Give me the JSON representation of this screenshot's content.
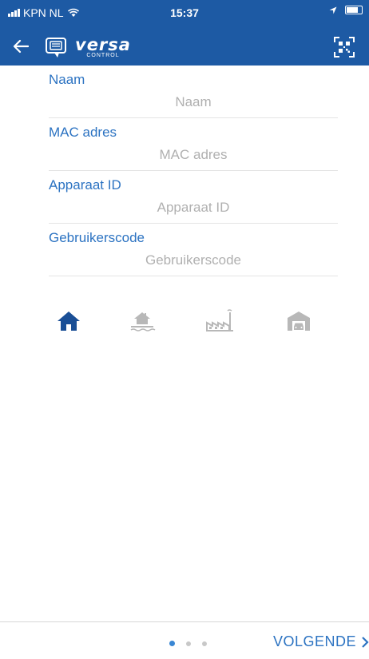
{
  "status": {
    "carrier": "KPN NL",
    "time": "15:37"
  },
  "header": {
    "brand": "versa",
    "brand_sub": "CONTROL"
  },
  "form": {
    "fields": [
      {
        "label": "Naam",
        "placeholder": "Naam",
        "value": ""
      },
      {
        "label": "MAC adres",
        "placeholder": "MAC adres",
        "value": ""
      },
      {
        "label": "Apparaat ID",
        "placeholder": "Apparaat ID",
        "value": ""
      },
      {
        "label": "Gebruikerscode",
        "placeholder": "Gebruikerscode",
        "value": ""
      }
    ]
  },
  "location_types": {
    "items": [
      {
        "icon": "house-icon",
        "selected": true
      },
      {
        "icon": "holiday-house-icon",
        "selected": false
      },
      {
        "icon": "factory-icon",
        "selected": false
      },
      {
        "icon": "garage-icon",
        "selected": false
      }
    ],
    "colors": {
      "selected": "#1a4f96",
      "unselected": "#b8b8b8"
    }
  },
  "footer": {
    "page_count": 3,
    "active_page": 1,
    "next_label": "VOLGENDE",
    "next_icon": "chevron-right-icon"
  },
  "colors": {
    "header_bg": "#1d5aa4",
    "accent": "#2c73c2"
  }
}
